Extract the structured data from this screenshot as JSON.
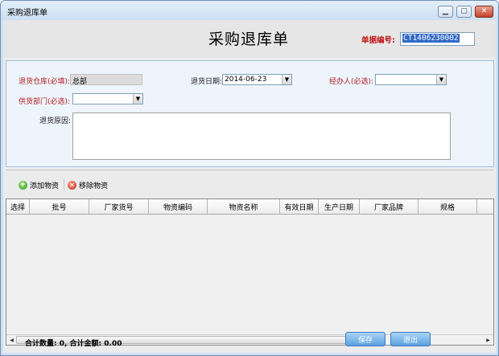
{
  "window": {
    "title": "采购退库单",
    "minimize_glyph": "▁",
    "maximize_glyph": "▢",
    "close_glyph": "✕"
  },
  "header": {
    "title": "采购退库单",
    "doc_no_label": "单据编号:",
    "doc_no_value": "CT1406230002"
  },
  "form": {
    "warehouse_label": "退货仓库(必填):",
    "warehouse_value": "总部",
    "return_date_label": "退货日期:",
    "return_date_value": "2014-06-23",
    "handler_label": "经办人(必选):",
    "handler_value": "",
    "supply_dept_label": "供货部门(必选):",
    "supply_dept_value": "",
    "reason_label": "退货原因:",
    "reason_value": ""
  },
  "toolbar": {
    "add_label": "添加物资",
    "remove_label": "移除物资"
  },
  "grid": {
    "columns": [
      "选择",
      "批号",
      "厂家货号",
      "物资编码",
      "物资名称",
      "有效日期",
      "生产日期",
      "厂家品牌",
      "规格"
    ],
    "rows": []
  },
  "footer": {
    "summary": "合计数量: 0, 合计金额: 0.00",
    "save_label": "保存",
    "exit_label": "退出"
  }
}
